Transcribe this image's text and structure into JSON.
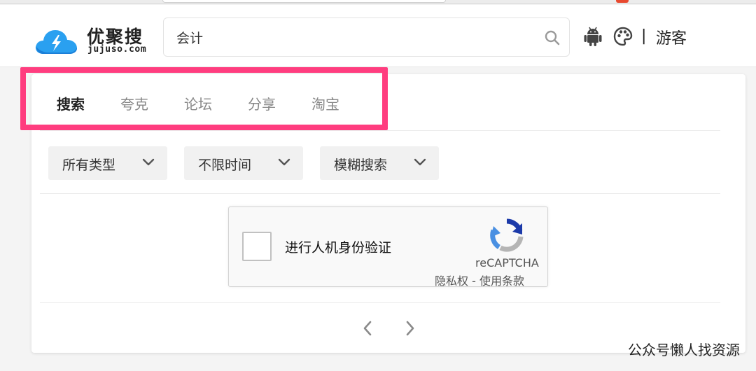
{
  "site": {
    "name": "优聚搜",
    "domain": "jujuso.com",
    "brand_color": "#2aa0f0"
  },
  "search": {
    "value": "会计"
  },
  "header": {
    "separator": "|",
    "user_label": "游客",
    "icons": [
      "android-icon",
      "palette-icon"
    ]
  },
  "tabs": [
    {
      "label": "搜索",
      "active": true
    },
    {
      "label": "夸克",
      "active": false
    },
    {
      "label": "论坛",
      "active": false
    },
    {
      "label": "分享",
      "active": false
    },
    {
      "label": "淘宝",
      "active": false
    }
  ],
  "highlight_color": "#ff3d7f",
  "filters": [
    {
      "label": "所有类型"
    },
    {
      "label": "不限时间"
    },
    {
      "label": "模糊搜索"
    }
  ],
  "recaptcha": {
    "label": "进行人机身份验证",
    "brand": "reCAPTCHA",
    "privacy": "隐私权",
    "dash": " - ",
    "terms": "使用条款"
  },
  "pager": {
    "prev_icon": "chevron-left-icon",
    "next_icon": "chevron-right-icon"
  },
  "watermark": "公众号懒人找资源"
}
